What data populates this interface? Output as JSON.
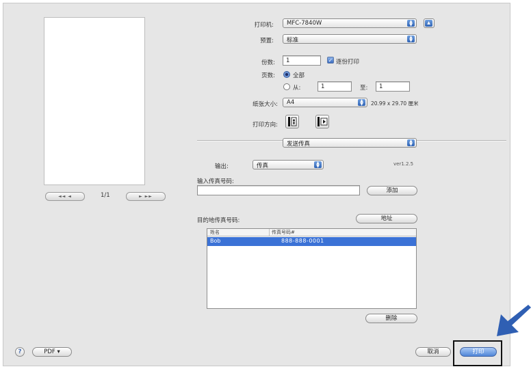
{
  "preview": {
    "page_indicator": "1/1",
    "first_label": "◄◄ ◄",
    "next_label": "► ►►"
  },
  "printer": {
    "label": "打印机:",
    "value": "MFC-7840W"
  },
  "presets": {
    "label": "预置:",
    "value": "标准"
  },
  "copies": {
    "label": "份数:",
    "value": "1",
    "collated_label": "逐份打印"
  },
  "pages": {
    "label": "页数:",
    "all_label": "全部",
    "from_label": "从:",
    "from_value": "1",
    "to_label": "至:",
    "to_value": "1"
  },
  "paper_size": {
    "label": "纸张大小:",
    "value": "A4",
    "dimensions": "20.99 x 29.70 厘米"
  },
  "orientation": {
    "label": "打印方向:"
  },
  "panel": {
    "value": "发送传真"
  },
  "output": {
    "label": "输出:",
    "value": "传真",
    "version": "ver1.2.5"
  },
  "fax_number": {
    "label": "输入传真号码:",
    "value": "",
    "add_button": "添加"
  },
  "destination": {
    "label": "目的地传真号码:",
    "address_button": "地址",
    "columns": [
      "姓名",
      "传真号码#"
    ],
    "rows": [
      {
        "name": "Bob",
        "fax": "888-888-0001"
      }
    ],
    "delete_button": "删除"
  },
  "footer": {
    "help": "?",
    "pdf_button": "PDF ▾",
    "cancel_button": "取消",
    "print_button": "打印"
  },
  "colors": {
    "accent": "#3b72d6",
    "arrow": "#2f5fb3"
  }
}
